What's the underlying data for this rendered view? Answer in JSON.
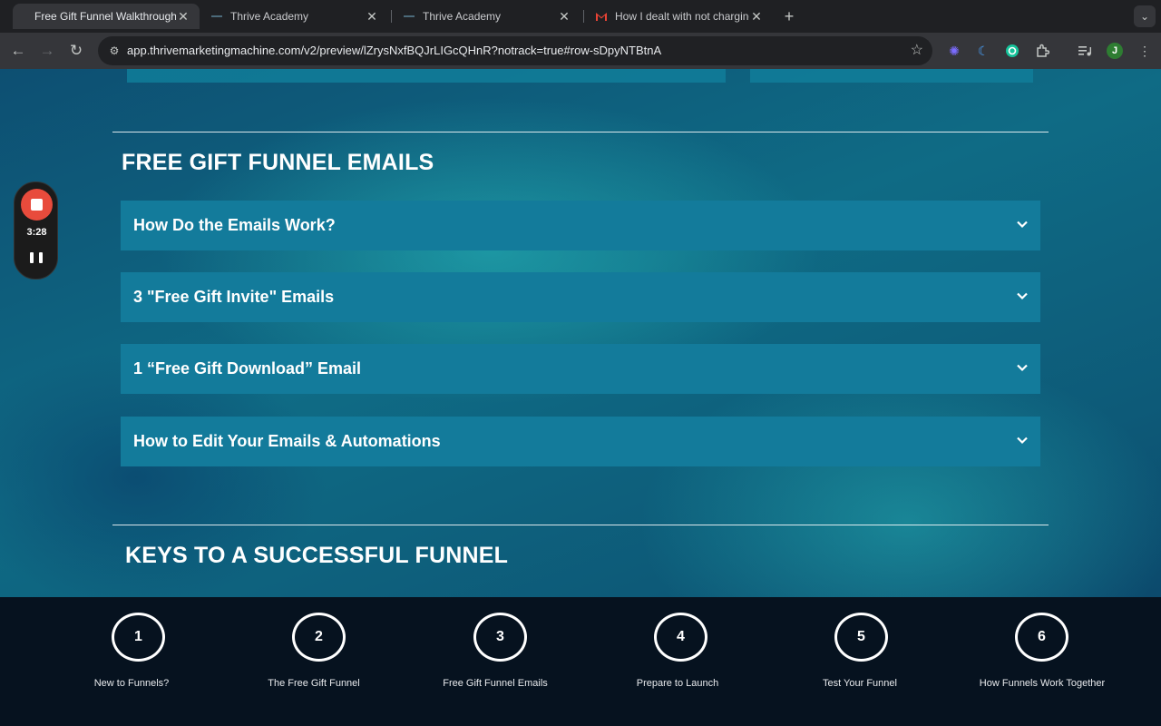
{
  "browser": {
    "tabs": [
      {
        "title": "Free Gift Funnel Walkthrough",
        "active": true,
        "icon": "blank-favicon"
      },
      {
        "title": "Thrive Academy",
        "active": false,
        "icon": "thrive-favicon"
      },
      {
        "title": "Thrive Academy",
        "active": false,
        "icon": "thrive-favicon"
      },
      {
        "title": "How I dealt with not charging",
        "active": false,
        "icon": "gmail-icon"
      }
    ],
    "url": "app.thrivemarketingmachine.com/v2/preview/lZrysNxfBQJrLIGcQHnR?notrack=true#row-sDpyNTBtnA",
    "profile_initial": "J"
  },
  "recorder": {
    "time": "3:28"
  },
  "sections": {
    "emails_title": "FREE GIFT FUNNEL EMAILS",
    "keys_title": "KEYS TO A SUCCESSFUL FUNNEL"
  },
  "accordion": [
    "How Do the Emails Work?",
    "3 \"Free Gift Invite\" Emails",
    "1 “Free Gift Download” Email",
    "How to Edit Your Emails & Automations"
  ],
  "steps": [
    {
      "num": "1",
      "label": "New to Funnels?"
    },
    {
      "num": "2",
      "label": "The Free Gift Funnel"
    },
    {
      "num": "3",
      "label": "Free Gift Funnel Emails"
    },
    {
      "num": "4",
      "label": "Prepare to Launch"
    },
    {
      "num": "5",
      "label": "Test Your Funnel"
    },
    {
      "num": "6",
      "label": "How Funnels Work Together"
    }
  ],
  "colors": {
    "accent_red": "#e84b3c",
    "accordion_bg": "#137b9b",
    "footer_bg": "#06121f"
  }
}
